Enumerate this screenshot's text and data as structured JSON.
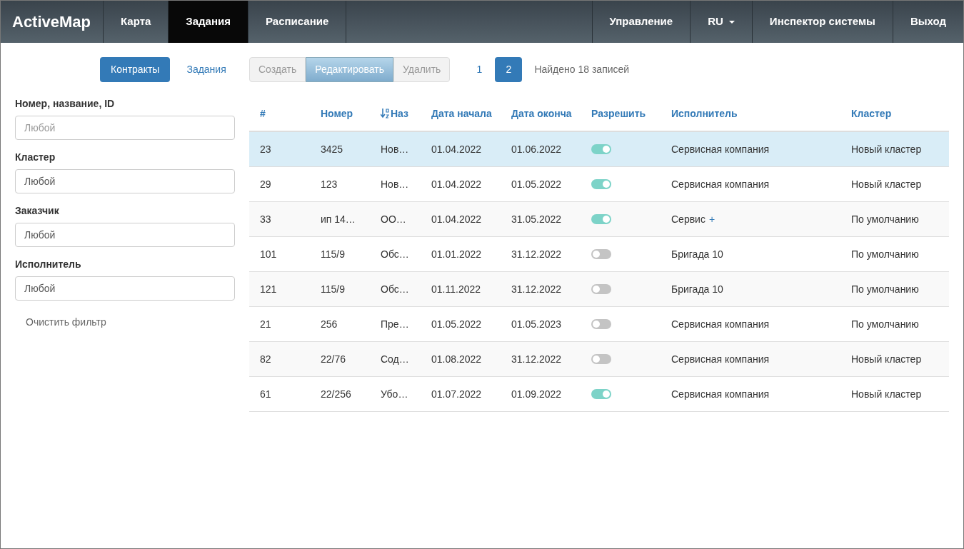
{
  "navbar": {
    "brand": "ActiveMap",
    "tabs": [
      {
        "label": "Карта",
        "selected": false
      },
      {
        "label": "Задания",
        "selected": true
      },
      {
        "label": "Расписание",
        "selected": false
      }
    ],
    "right_items": [
      {
        "label": "Управление",
        "kind": "link"
      },
      {
        "label": "RU",
        "kind": "dropdown"
      },
      {
        "label": "Инспектор системы",
        "kind": "link"
      },
      {
        "label": "Выход",
        "kind": "link"
      }
    ]
  },
  "mode_tabs": [
    {
      "label": "Контракты",
      "selected": true
    },
    {
      "label": "Задания",
      "selected": false
    }
  ],
  "filters": [
    {
      "label": "Номер, название, ID",
      "placeholder": "Любой"
    },
    {
      "label": "Кластер",
      "value": "Любой"
    },
    {
      "label": "Заказчик",
      "value": "Любой"
    },
    {
      "label": "Исполнитель",
      "value": "Любой"
    }
  ],
  "clear_filter": "Очистить фильтр",
  "actions": [
    {
      "label": "Создать",
      "disabled": true,
      "selected": false
    },
    {
      "label": "Редактировать",
      "disabled": true,
      "selected": true
    },
    {
      "label": "Удалить",
      "disabled": true,
      "selected": false
    }
  ],
  "pages": [
    {
      "label": "1",
      "selected": false
    },
    {
      "label": "2",
      "selected": true
    }
  ],
  "found": "Найдено 18 записей",
  "table": {
    "columns": [
      {
        "label": "#",
        "sorted": false
      },
      {
        "label": "Номер",
        "sorted": false
      },
      {
        "label": "Наз",
        "sorted": true
      },
      {
        "label": "Дата начала",
        "sorted": false
      },
      {
        "label": "Дата оконча",
        "sorted": false
      },
      {
        "label": "Разрешить",
        "sorted": false
      },
      {
        "label": "Исполнитель",
        "sorted": false
      },
      {
        "label": "Кластер",
        "sorted": false
      }
    ],
    "rows": [
      {
        "selected": true,
        "id": "23",
        "number": "3425",
        "name": "Нов…",
        "start": "01.04.2022",
        "end": "01.06.2022",
        "allowed": true,
        "executor": "Сервисная компания",
        "cluster": "Новый кластер"
      },
      {
        "selected": false,
        "id": "29",
        "number": "123",
        "name": "Нов…",
        "start": "01.04.2022",
        "end": "01.05.2022",
        "allowed": true,
        "executor": "Сервисная компания",
        "cluster": "Новый кластер"
      },
      {
        "selected": false,
        "id": "33",
        "number": "ип 14…",
        "name": "ОО…",
        "start": "01.04.2022",
        "end": "31.05.2022",
        "allowed": true,
        "executor": "Сервис",
        "executor_link": "+",
        "cluster": "По умолчанию"
      },
      {
        "selected": false,
        "id": "101",
        "number": "115/9",
        "name": "Обс…",
        "start": "01.01.2022",
        "end": "31.12.2022",
        "allowed": false,
        "executor": "Бригада 10",
        "cluster": "По умолчанию"
      },
      {
        "selected": false,
        "id": "121",
        "number": "115/9",
        "name": "Обс…",
        "start": "01.11.2022",
        "end": "31.12.2022",
        "allowed": false,
        "executor": "Бригада 10",
        "cluster": "По умолчанию"
      },
      {
        "selected": false,
        "id": "21",
        "number": "256",
        "name": "Пре…",
        "start": "01.05.2022",
        "end": "01.05.2023",
        "allowed": false,
        "executor": "Сервисная компания",
        "cluster": "По умолчанию"
      },
      {
        "selected": false,
        "id": "82",
        "number": "22/76",
        "name": "Сод…",
        "start": "01.08.2022",
        "end": "31.12.2022",
        "allowed": false,
        "executor": "Сервисная компания",
        "cluster": "Новый кластер"
      },
      {
        "selected": false,
        "id": "61",
        "number": "22/256",
        "name": "Убо…",
        "start": "01.07.2022",
        "end": "01.09.2022",
        "allowed": true,
        "executor": "Сервисная компания",
        "cluster": "Новый кластер"
      }
    ]
  }
}
